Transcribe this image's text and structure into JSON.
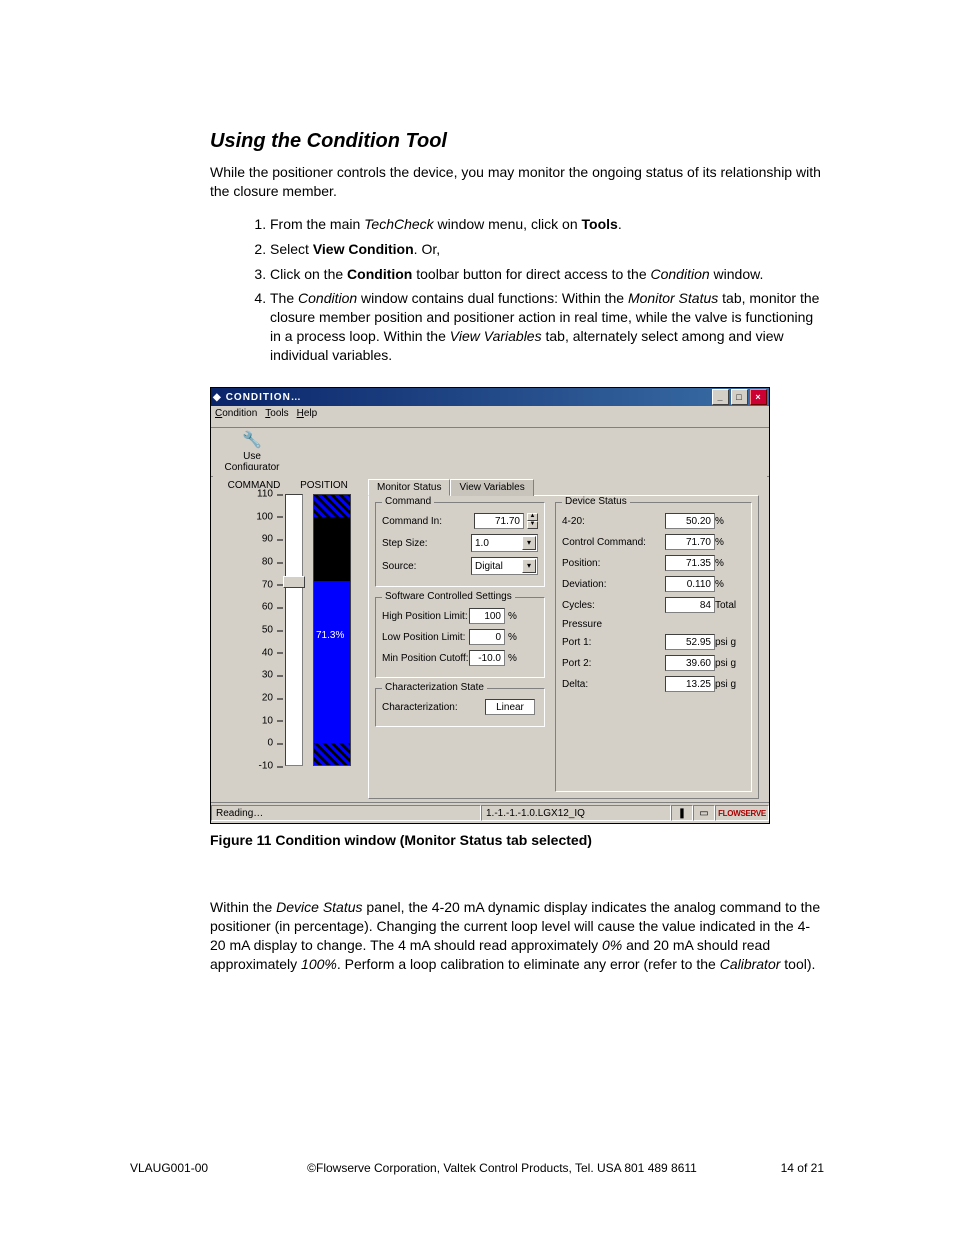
{
  "heading": "Using the Condition Tool",
  "intro": "While the positioner controls the device, you may monitor the ongoing status of its relationship with the closure member.",
  "list": {
    "i1a": "From the main ",
    "i1b": "TechCheck",
    "i1c": " window menu, click on ",
    "i1d": "Tools",
    "i1e": ".",
    "i2a": "Select ",
    "i2b": "View Condition",
    "i2c": ".  Or,",
    "i3a": "Click on the ",
    "i3b": "Condition",
    "i3c": " toolbar button for direct access to the ",
    "i3d": "Condition",
    "i3e": " window.",
    "i4a": "The ",
    "i4b": "Condition",
    "i4c": " window contains dual functions: Within the ",
    "i4d": "Monitor Status",
    "i4e": " tab, monitor the closure member position and positioner action in real time, while the valve is functioning in a process loop.  Within the ",
    "i4f": "View Variables",
    "i4g": " tab, alternately select among and view individual variables."
  },
  "win": {
    "title": "CONDITION…",
    "menu": {
      "m1": "Condition",
      "m2": "Tools",
      "m3": "Help"
    },
    "toolbar_btn": "Use Configurator",
    "gauge_hdr": {
      "c": "COMMAND",
      "p": "POSITION"
    },
    "ticks": [
      "110",
      "100",
      "90",
      "80",
      "70",
      "60",
      "50",
      "40",
      "30",
      "20",
      "10",
      "0",
      "-10"
    ],
    "bar_label": "71.3%",
    "tabs": {
      "t1": "Monitor Status",
      "t2": "View Variables"
    },
    "grp_command": "Command",
    "cmd": {
      "in_l": "Command In:",
      "in_v": "71.70",
      "step_l": "Step Size:",
      "step_v": "1.0",
      "src_l": "Source:",
      "src_v": "Digital"
    },
    "grp_swc": "Software Controlled Settings",
    "swc": {
      "hpl_l": "High Position Limit:",
      "hpl_v": "100",
      "lpl_l": "Low Position Limit:",
      "lpl_v": "0",
      "mpc_l": "Min Position Cutoff:",
      "mpc_v": "-10.0",
      "unit": "%"
    },
    "grp_char": "Characterization State",
    "char": {
      "l": "Characterization:",
      "v": "Linear"
    },
    "grp_dev": "Device Status",
    "dev": {
      "a_l": "4-20:",
      "a_v": "50.20",
      "a_u": "%",
      "b_l": "Control Command:",
      "b_v": "71.70",
      "b_u": "%",
      "c_l": "Position:",
      "c_v": "71.35",
      "c_u": "%",
      "d_l": "Deviation:",
      "d_v": "0.110",
      "d_u": "%",
      "e_l": "Cycles:",
      "e_v": "84",
      "e_u": "Total",
      "press": "Pressure",
      "f_l": "Port 1:",
      "f_v": "52.95",
      "f_u": "psi g",
      "g_l": "Port 2:",
      "g_v": "39.60",
      "g_u": "psi g",
      "h_l": "Delta:",
      "h_v": "13.25",
      "h_u": "psi g"
    },
    "status": {
      "s1": "Reading…",
      "s2": "1.-1.-1.-1.0.LGX12_IQ",
      "logo": "FLOWSERVE"
    }
  },
  "caption": "Figure 11 Condition window (Monitor Status tab selected)",
  "after": {
    "a": "Within the ",
    "b": "Device Status",
    "c": " panel, the 4-20 mA dynamic display indicates the analog command to the positioner (in percentage).  Changing the current loop level will cause the value indicated in the 4-20 mA display to change.  The 4 mA should read approximately ",
    "d": "0%",
    "e": " and 20 mA should read approximately ",
    "f": "100%",
    "g": ".  Perform a loop calibration to eliminate any error (refer to the ",
    "h": "Calibrator",
    "i": " tool)."
  },
  "footer": {
    "l": "VLAUG001-00",
    "c": "©Flowserve Corporation, Valtek Control Products, Tel. USA 801 489 8611",
    "r": "14 of 21"
  }
}
